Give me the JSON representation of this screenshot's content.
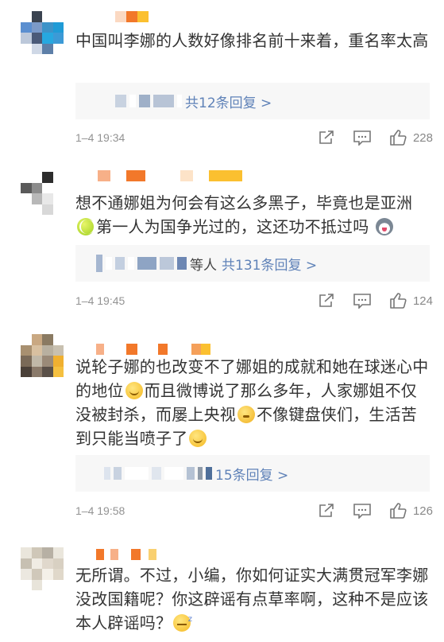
{
  "comments": [
    {
      "text": "中国叫李娜的人数好像排名前十来着，重名率太高",
      "replies_label": "共12条回复 >",
      "time": "1–4 19:34",
      "likes": "228"
    },
    {
      "text_a": "想不通娜姐为何会有这么多黑子，毕竟也是亚洲",
      "text_b": "第一人为国争光过的，这还功不抵过吗",
      "replies_by": "等人",
      "replies_label": "共131条回复 >",
      "time": "1–4 19:45",
      "likes": "124"
    },
    {
      "text_a": "说轮子娜的也改变不了娜姐的成就和她在球迷心中的地位",
      "text_b": "而且微博说了那么多年，人家娜姐不仅没被封杀，而屡上央视",
      "text_c": "不像键盘侠们，生活苦到只能当喷子了",
      "replies_label": "15条回复 >",
      "time": "1–4 19:58",
      "likes": "126"
    },
    {
      "text_a": "无所谓。不过，小编，你如何证实大满贯冠军李娜没改国籍呢？你这辟谣有点草率啊，这种不是应该本人辟谣吗？"
    }
  ],
  "icons": {
    "share": "share-icon",
    "comment": "comment-icon",
    "like": "thumbs-up-icon"
  },
  "colors": {
    "link": "#5f82b8",
    "meta": "#939393",
    "reply_bg": "#f7f7f7"
  }
}
